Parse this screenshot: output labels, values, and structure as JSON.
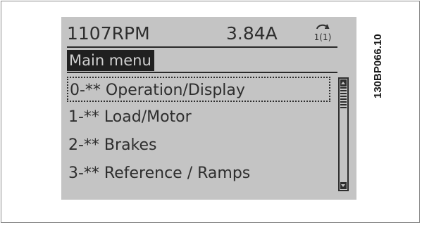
{
  "status": {
    "speed": "1107RPM",
    "current": "3.84A",
    "setup_indicator": "1(1)"
  },
  "menu": {
    "title": "Main menu",
    "items": [
      {
        "label": "0-** Operation/Display",
        "selected": true
      },
      {
        "label": "1-** Load/Motor",
        "selected": false
      },
      {
        "label": "2-** Brakes",
        "selected": false
      },
      {
        "label": "3-** Reference / Ramps",
        "selected": false
      }
    ]
  },
  "icons": {
    "setup": "setup-icon",
    "scroll_up": "arrow-up-icon",
    "scroll_down": "arrow-down-icon"
  },
  "colors": {
    "lcd_background": "#c4c4c4",
    "lcd_text": "#2e2e2e",
    "title_highlight": "#202020"
  },
  "figure_ref": "130BP066.10"
}
